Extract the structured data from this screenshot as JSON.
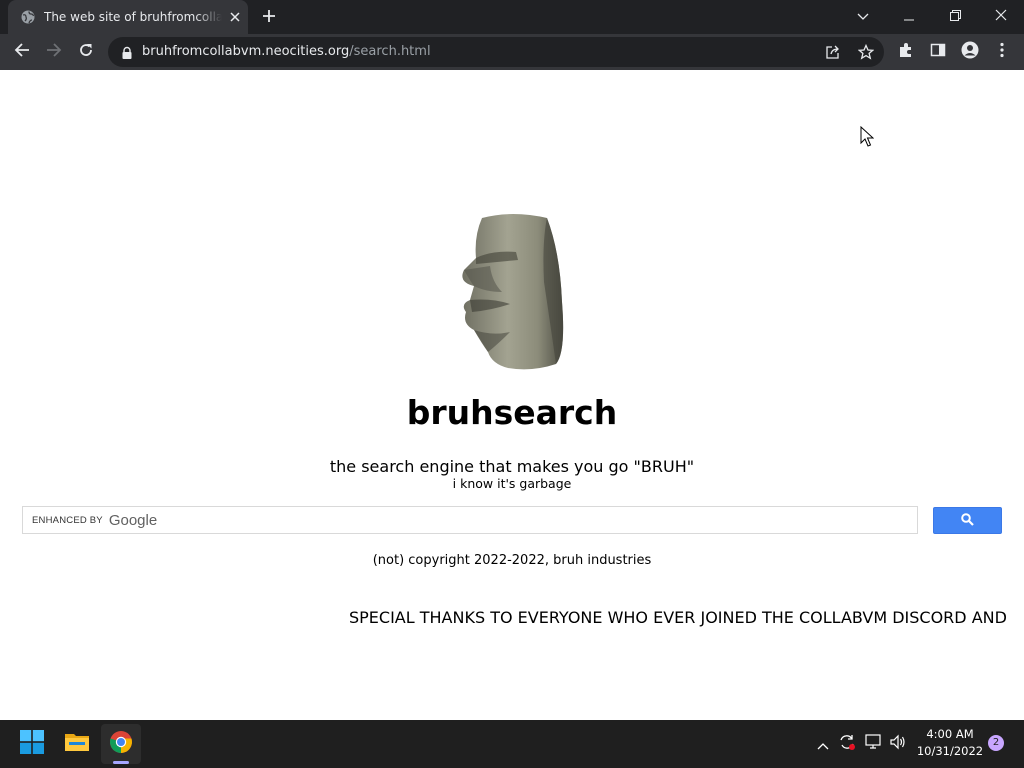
{
  "browser": {
    "tab": {
      "title": "The web site of bruhfromcollabvm",
      "favicon": "globe-icon",
      "close_glyph": "✕"
    },
    "new_tab_icon": "plus-icon",
    "window_controls": [
      "chevron-down-icon",
      "minimize-icon",
      "restore-icon",
      "close-icon"
    ],
    "toolbar": {
      "url_host": "bruhfromcollabvm.neocities.org",
      "url_path": "/search.html"
    }
  },
  "page": {
    "logo_image": "moai-head",
    "site_title": "bruhsearch",
    "tagline": "the search engine that makes you go \"BRUH\"",
    "subtagline": "i know it's garbage",
    "search": {
      "enhanced_by": "ENHANCED BY",
      "google": "Google",
      "button_icon": "search-icon",
      "button_color": "#4285f4"
    },
    "copyright": "(not) copyright 2022-2022, bruh industries",
    "marquee": "SPECIAL THANKS TO EVERYONE WHO EVER JOINED THE COLLABVM DISCORD AND"
  },
  "taskbar": {
    "apps": [
      "windows-start-icon",
      "file-explorer-icon",
      "chrome-icon"
    ],
    "tray": [
      "chevron-up-icon",
      "sync-icon",
      "network-icon",
      "volume-icon"
    ],
    "time": "4:00 AM",
    "date": "10/31/2022",
    "notifications": "2"
  }
}
